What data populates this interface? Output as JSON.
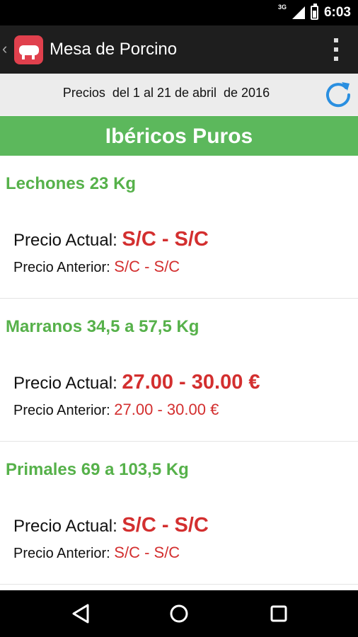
{
  "status_bar": {
    "network": "3G",
    "time": "6:03"
  },
  "app_bar": {
    "title": "Mesa de Porcino"
  },
  "subheader": {
    "dates": "Precios  del 1 al 21 de abril  de 2016"
  },
  "section": {
    "title": "Ibéricos Puros"
  },
  "labels": {
    "current": "Precio Actual: ",
    "previous": "Precio Anterior: "
  },
  "items": [
    {
      "title": "Lechones 23 Kg",
      "current": "S/C - S/C",
      "previous": "S/C - S/C"
    },
    {
      "title": "Marranos 34,5 a 57,5 Kg",
      "current": "27.00 - 30.00 €",
      "previous": "27.00 - 30.00 €"
    },
    {
      "title": "Primales 69 a 103,5 Kg",
      "current": "S/C - S/C",
      "previous": "S/C - S/C"
    }
  ],
  "colors": {
    "accent_green": "#5cb85c",
    "price_red": "#d32f2f",
    "refresh_blue": "#2a8fe0",
    "app_bar": "#1e1e1e"
  },
  "icons": [
    "back-icon",
    "app-logo",
    "overflow-menu-icon",
    "refresh-icon",
    "nav-back-icon",
    "nav-home-icon",
    "nav-recents-icon"
  ]
}
